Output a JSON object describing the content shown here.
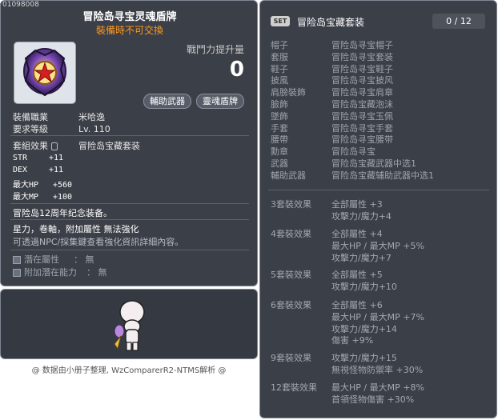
{
  "item": {
    "id": "01098008",
    "name": "冒险岛寻宝灵魂盾牌",
    "trade": "裝備時不可交換",
    "power_label": "戰鬥力提升量",
    "power_value": "0",
    "tags": [
      "輔助武器",
      "靈魂盾牌"
    ],
    "job_label": "裝備職業",
    "job_value": "米哈逸",
    "level_label": "要求等級",
    "level_value": "Lv. 110",
    "set_label": "套組效果",
    "set_value": "冒险岛宝藏套装",
    "stats": [
      {
        "name": "STR",
        "value": "+11"
      },
      {
        "name": "DEX",
        "value": "+11"
      },
      {
        "name": "最大HP",
        "value": "+560"
      },
      {
        "name": "最大MP",
        "value": "+100"
      }
    ],
    "desc1": "冒险岛12周年纪念装备。",
    "desc2": "星力，卷軸，附加屬性 無法強化",
    "desc3": "可透過NPC/採集鍵查看強化資訊詳細內容。",
    "pot_label": "潛在屬性",
    "pot_value": "： 無",
    "addpot_label": "附加潛在能力",
    "addpot_value": "： 無",
    "icon": "soul-shield-icon",
    "colors": {
      "title": "#ffffff",
      "trade": "#ff9a1f",
      "panel": "#3b3f47"
    }
  },
  "credit": "@ 数据由小册子整理, WzComparerR2-NTMS解析 @",
  "set": {
    "badge": "SET",
    "name": "冒险岛宝藏套装",
    "count": "0 / 12",
    "items": [
      {
        "slot": "帽子",
        "name": "冒险岛寻宝帽子"
      },
      {
        "slot": "套服",
        "name": "冒险岛寻宝套装"
      },
      {
        "slot": "鞋子",
        "name": "冒险岛寻宝鞋子"
      },
      {
        "slot": "披風",
        "name": "冒险岛寻宝披风"
      },
      {
        "slot": "肩膀裝飾",
        "name": "冒险岛寻宝肩章"
      },
      {
        "slot": "臉飾",
        "name": "冒险岛宝藏泡沫"
      },
      {
        "slot": "墜飾",
        "name": "冒险岛寻宝玉佩"
      },
      {
        "slot": "手套",
        "name": "冒险岛寻宝手套"
      },
      {
        "slot": "腰帶",
        "name": "冒险岛寻宝腰带"
      },
      {
        "slot": "勳章",
        "name": "冒险岛寻宝"
      },
      {
        "slot": "武器",
        "name": "冒险岛宝藏武器中选1"
      },
      {
        "slot": "輔助武器",
        "name": "冒险岛宝藏辅助武器中选1"
      }
    ],
    "effects": [
      {
        "label": "3套裝效果",
        "lines": [
          "全部屬性 +3",
          "攻擊力/魔力+4"
        ]
      },
      {
        "label": "4套裝效果",
        "lines": [
          "全部屬性 +4",
          "最大HP / 最大MP +5%",
          "攻擊力/魔力+7"
        ]
      },
      {
        "label": "5套裝效果",
        "lines": [
          "全部屬性 +5",
          "攻擊力/魔力+10"
        ]
      },
      {
        "label": "6套裝效果",
        "lines": [
          "全部屬性 +6",
          "最大HP / 最大MP +7%",
          "攻擊力/魔力+14",
          "傷害 +9%"
        ]
      },
      {
        "label": "9套裝效果",
        "lines": [
          "攻擊力/魔力+15",
          "無視怪物防禦率 +30%"
        ]
      },
      {
        "label": "12套裝效果",
        "lines": [
          "最大HP / 最大MP +8%",
          "首領怪物傷害 +30%"
        ]
      }
    ]
  }
}
